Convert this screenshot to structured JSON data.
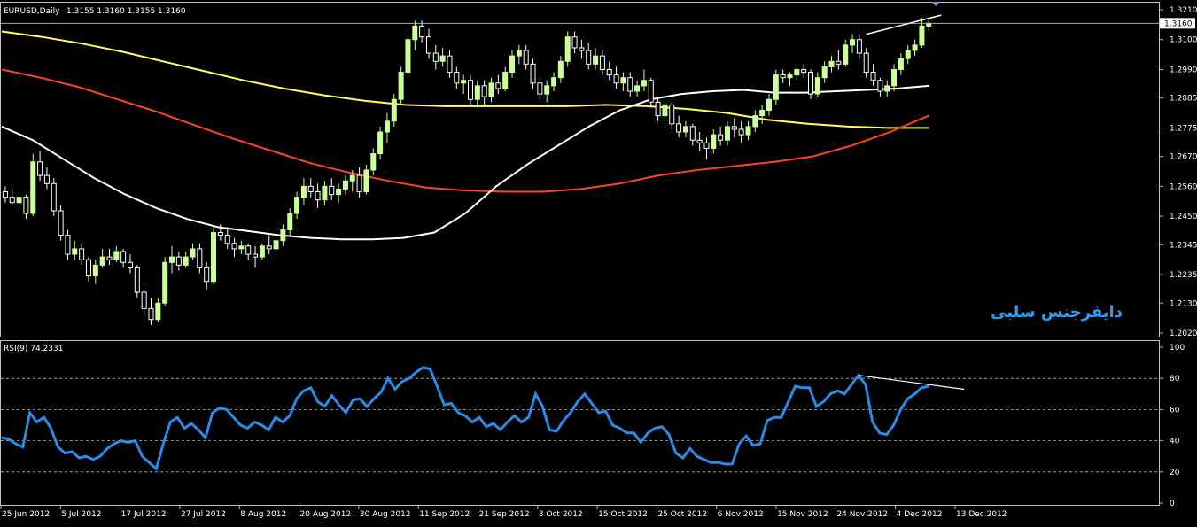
{
  "chart_data": [
    {
      "type": "candlestick",
      "title": "EURUSD,Daily",
      "ohlc_text": "1.3155 1.3160 1.3155 1.3160",
      "current_price": "1.3160",
      "annotation": "دایفرجنس سلبی",
      "y_ticks": [
        "1.3210",
        "1.3100",
        "1.2990",
        "1.2885",
        "1.2775",
        "1.2670",
        "1.2560",
        "1.2450",
        "1.2345",
        "1.2235",
        "1.2130",
        "1.2020"
      ],
      "ylim": [
        1.202,
        1.321
      ],
      "candles": [
        [
          1.254,
          1.256,
          1.25,
          1.252
        ],
        [
          1.252,
          1.2545,
          1.249,
          1.25
        ],
        [
          1.25,
          1.253,
          1.248,
          1.252
        ],
        [
          1.252,
          1.253,
          1.244,
          1.246
        ],
        [
          1.246,
          1.268,
          1.245,
          1.265
        ],
        [
          1.265,
          1.269,
          1.258,
          1.26
        ],
        [
          1.26,
          1.263,
          1.255,
          1.257
        ],
        [
          1.257,
          1.259,
          1.245,
          1.247
        ],
        [
          1.247,
          1.249,
          1.236,
          1.238
        ],
        [
          1.238,
          1.24,
          1.229,
          1.231
        ],
        [
          1.231,
          1.236,
          1.229,
          1.233
        ],
        [
          1.233,
          1.235,
          1.227,
          1.229
        ],
        [
          1.229,
          1.23,
          1.221,
          1.223
        ],
        [
          1.223,
          1.229,
          1.22,
          1.227
        ],
        [
          1.227,
          1.233,
          1.226,
          1.23
        ],
        [
          1.23,
          1.233,
          1.227,
          1.229
        ],
        [
          1.229,
          1.234,
          1.228,
          1.232
        ],
        [
          1.232,
          1.233,
          1.226,
          1.228
        ],
        [
          1.228,
          1.231,
          1.224,
          1.226
        ],
        [
          1.226,
          1.227,
          1.215,
          1.217
        ],
        [
          1.217,
          1.218,
          1.208,
          1.211
        ],
        [
          1.211,
          1.215,
          1.205,
          1.207
        ],
        [
          1.207,
          1.215,
          1.206,
          1.213
        ],
        [
          1.213,
          1.23,
          1.212,
          1.228
        ],
        [
          1.228,
          1.234,
          1.224,
          1.23
        ],
        [
          1.23,
          1.232,
          1.225,
          1.227
        ],
        [
          1.227,
          1.232,
          1.226,
          1.23
        ],
        [
          1.23,
          1.235,
          1.229,
          1.233
        ],
        [
          1.233,
          1.235,
          1.224,
          1.226
        ],
        [
          1.226,
          1.228,
          1.218,
          1.221
        ],
        [
          1.221,
          1.241,
          1.22,
          1.239
        ],
        [
          1.239,
          1.242,
          1.236,
          1.238
        ],
        [
          1.238,
          1.241,
          1.233,
          1.235
        ],
        [
          1.235,
          1.237,
          1.23,
          1.233
        ],
        [
          1.233,
          1.236,
          1.231,
          1.234
        ],
        [
          1.234,
          1.235,
          1.229,
          1.231
        ],
        [
          1.231,
          1.234,
          1.226,
          1.23
        ],
        [
          1.23,
          1.235,
          1.229,
          1.234
        ],
        [
          1.234,
          1.238,
          1.231,
          1.233
        ],
        [
          1.233,
          1.237,
          1.23,
          1.236
        ],
        [
          1.236,
          1.242,
          1.234,
          1.24
        ],
        [
          1.24,
          1.248,
          1.238,
          1.246
        ],
        [
          1.246,
          1.254,
          1.244,
          1.252
        ],
        [
          1.252,
          1.259,
          1.249,
          1.256
        ],
        [
          1.256,
          1.259,
          1.252,
          1.254
        ],
        [
          1.254,
          1.257,
          1.248,
          1.251
        ],
        [
          1.251,
          1.258,
          1.249,
          1.256
        ],
        [
          1.256,
          1.259,
          1.251,
          1.253
        ],
        [
          1.253,
          1.257,
          1.25,
          1.255
        ],
        [
          1.255,
          1.26,
          1.253,
          1.258
        ],
        [
          1.258,
          1.262,
          1.254,
          1.26
        ],
        [
          1.26,
          1.263,
          1.252,
          1.254
        ],
        [
          1.254,
          1.264,
          1.253,
          1.262
        ],
        [
          1.262,
          1.27,
          1.26,
          1.268
        ],
        [
          1.268,
          1.278,
          1.266,
          1.276
        ],
        [
          1.276,
          1.283,
          1.272,
          1.28
        ],
        [
          1.28,
          1.29,
          1.278,
          1.288
        ],
        [
          1.288,
          1.3,
          1.286,
          1.298
        ],
        [
          1.298,
          1.312,
          1.296,
          1.31
        ],
        [
          1.31,
          1.317,
          1.306,
          1.315
        ],
        [
          1.315,
          1.317,
          1.309,
          1.311
        ],
        [
          1.311,
          1.314,
          1.303,
          1.305
        ],
        [
          1.305,
          1.308,
          1.299,
          1.302
        ],
        [
          1.302,
          1.307,
          1.3,
          1.304
        ],
        [
          1.304,
          1.306,
          1.296,
          1.298
        ],
        [
          1.298,
          1.3,
          1.292,
          1.294
        ],
        [
          1.294,
          1.297,
          1.29,
          1.295
        ],
        [
          1.295,
          1.297,
          1.286,
          1.288
        ],
        [
          1.288,
          1.295,
          1.285,
          1.293
        ],
        [
          1.293,
          1.295,
          1.286,
          1.289
        ],
        [
          1.289,
          1.296,
          1.287,
          1.294
        ],
        [
          1.294,
          1.297,
          1.29,
          1.292
        ],
        [
          1.292,
          1.3,
          1.291,
          1.298
        ],
        [
          1.298,
          1.306,
          1.296,
          1.304
        ],
        [
          1.304,
          1.308,
          1.301,
          1.306
        ],
        [
          1.306,
          1.308,
          1.299,
          1.301
        ],
        [
          1.301,
          1.303,
          1.292,
          1.294
        ],
        [
          1.294,
          1.296,
          1.287,
          1.29
        ],
        [
          1.29,
          1.295,
          1.287,
          1.293
        ],
        [
          1.293,
          1.298,
          1.291,
          1.296
        ],
        [
          1.296,
          1.304,
          1.294,
          1.302
        ],
        [
          1.302,
          1.313,
          1.3,
          1.311
        ],
        [
          1.311,
          1.313,
          1.305,
          1.307
        ],
        [
          1.307,
          1.31,
          1.303,
          1.306
        ],
        [
          1.306,
          1.309,
          1.299,
          1.301
        ],
        [
          1.301,
          1.307,
          1.299,
          1.304
        ],
        [
          1.304,
          1.306,
          1.297,
          1.299
        ],
        [
          1.299,
          1.302,
          1.295,
          1.297
        ],
        [
          1.297,
          1.3,
          1.292,
          1.294
        ],
        [
          1.294,
          1.298,
          1.291,
          1.296
        ],
        [
          1.296,
          1.298,
          1.289,
          1.291
        ],
        [
          1.291,
          1.295,
          1.289,
          1.293
        ],
        [
          1.293,
          1.299,
          1.291,
          1.295
        ],
        [
          1.295,
          1.296,
          1.285,
          1.287
        ],
        [
          1.287,
          1.289,
          1.28,
          1.282
        ],
        [
          1.282,
          1.288,
          1.28,
          1.286
        ],
        [
          1.286,
          1.287,
          1.277,
          1.279
        ],
        [
          1.279,
          1.282,
          1.274,
          1.276
        ],
        [
          1.276,
          1.28,
          1.274,
          1.278
        ],
        [
          1.278,
          1.279,
          1.271,
          1.273
        ],
        [
          1.273,
          1.276,
          1.269,
          1.272
        ],
        [
          1.272,
          1.274,
          1.266,
          1.27
        ],
        [
          1.27,
          1.277,
          1.268,
          1.275
        ],
        [
          1.275,
          1.278,
          1.271,
          1.273
        ],
        [
          1.273,
          1.28,
          1.271,
          1.278
        ],
        [
          1.278,
          1.281,
          1.274,
          1.277
        ],
        [
          1.277,
          1.28,
          1.272,
          1.275
        ],
        [
          1.275,
          1.28,
          1.273,
          1.278
        ],
        [
          1.278,
          1.284,
          1.276,
          1.282
        ],
        [
          1.282,
          1.286,
          1.279,
          1.284
        ],
        [
          1.284,
          1.29,
          1.282,
          1.288
        ],
        [
          1.288,
          1.299,
          1.286,
          1.297
        ],
        [
          1.297,
          1.299,
          1.294,
          1.296
        ],
        [
          1.296,
          1.298,
          1.293,
          1.297
        ],
        [
          1.297,
          1.301,
          1.295,
          1.299
        ],
        [
          1.299,
          1.301,
          1.296,
          1.298
        ],
        [
          1.298,
          1.299,
          1.288,
          1.29
        ],
        [
          1.29,
          1.298,
          1.289,
          1.296
        ],
        [
          1.296,
          1.302,
          1.294,
          1.3
        ],
        [
          1.3,
          1.304,
          1.298,
          1.302
        ],
        [
          1.302,
          1.306,
          1.299,
          1.301
        ],
        [
          1.301,
          1.31,
          1.3,
          1.308
        ],
        [
          1.308,
          1.312,
          1.305,
          1.31
        ],
        [
          1.31,
          1.312,
          1.303,
          1.305
        ],
        [
          1.305,
          1.307,
          1.296,
          1.298
        ],
        [
          1.298,
          1.301,
          1.293,
          1.295
        ],
        [
          1.295,
          1.296,
          1.289,
          1.291
        ],
        [
          1.291,
          1.295,
          1.289,
          1.293
        ],
        [
          1.293,
          1.301,
          1.291,
          1.299
        ],
        [
          1.299,
          1.305,
          1.297,
          1.303
        ],
        [
          1.303,
          1.308,
          1.301,
          1.306
        ],
        [
          1.306,
          1.31,
          1.304,
          1.308
        ],
        [
          1.308,
          1.318,
          1.307,
          1.315
        ],
        [
          1.315,
          1.318,
          1.313,
          1.316
        ]
      ],
      "ma_series": [
        {
          "color": "#ffff66",
          "values": [
            1.313,
            1.311,
            1.3085,
            1.3055,
            1.302,
            1.2985,
            1.295,
            1.292,
            1.2895,
            1.2875,
            1.286,
            1.2855,
            1.2855,
            1.2855,
            1.2855,
            1.286,
            1.2855,
            1.2845,
            1.283,
            1.2805,
            1.279,
            1.278,
            1.2775,
            1.2775
          ]
        },
        {
          "color": "#ff4422",
          "values": [
            1.299,
            1.296,
            1.2925,
            1.288,
            1.2835,
            1.2785,
            1.2735,
            1.269,
            1.2645,
            1.261,
            1.258,
            1.2555,
            1.2545,
            1.254,
            1.254,
            1.255,
            1.257,
            1.26,
            1.262,
            1.2635,
            1.265,
            1.267,
            1.271,
            1.276,
            1.282
          ]
        },
        {
          "color": "#ffffff",
          "values": [
            1.278,
            1.273,
            1.266,
            1.259,
            1.253,
            1.248,
            1.244,
            1.241,
            1.2395,
            1.238,
            1.237,
            1.2365,
            1.2365,
            1.237,
            1.239,
            1.246,
            1.256,
            1.264,
            1.271,
            1.278,
            1.284,
            1.288,
            1.29,
            1.291,
            1.2915,
            1.2905,
            1.2905,
            1.291,
            1.2915,
            1.292,
            1.293
          ]
        }
      ],
      "trendline": [
        [
          1.312,
          1.319
        ]
      ]
    },
    {
      "type": "line",
      "title": "RSI(9) 74.2331",
      "y_ticks": [
        "100",
        "80",
        "60",
        "40",
        "20",
        "0"
      ],
      "ylim": [
        0,
        100
      ],
      "x_ticks": [
        "25 Jun 2012",
        "5 Jul 2012",
        "17 Jul 2012",
        "27 Jul 2012",
        "8 Aug 2012",
        "20 Aug 2012",
        "30 Aug 2012",
        "11 Sep 2012",
        "21 Sep 2012",
        "3 Oct 2012",
        "15 Oct 2012",
        "25 Oct 2012",
        "6 Nov 2012",
        "15 Nov 2012",
        "24 Nov 2012",
        "4 Dec 2012",
        "13 Dec 2012"
      ],
      "values": [
        42,
        41,
        38,
        36,
        58,
        52,
        55,
        48,
        36,
        32,
        33,
        29,
        30,
        28,
        30,
        35,
        38,
        40,
        39,
        40,
        30,
        26,
        22,
        38,
        52,
        55,
        48,
        51,
        47,
        42,
        58,
        61,
        60,
        55,
        50,
        48,
        52,
        50,
        47,
        55,
        52,
        56,
        67,
        72,
        74,
        65,
        62,
        69,
        63,
        58,
        66,
        67,
        62,
        67,
        71,
        80,
        73,
        78,
        80,
        84,
        87,
        86,
        75,
        63,
        64,
        58,
        56,
        52,
        55,
        49,
        51,
        47,
        52,
        56,
        52,
        55,
        70,
        62,
        47,
        46,
        53,
        58,
        65,
        70,
        64,
        58,
        59,
        50,
        48,
        45,
        45,
        39,
        45,
        48,
        49,
        44,
        32,
        29,
        35,
        30,
        28,
        26,
        26,
        25,
        25,
        38,
        43,
        37,
        38,
        53,
        55,
        55,
        65,
        75,
        74,
        74,
        62,
        65,
        70,
        72,
        70,
        76,
        82,
        76,
        52,
        45,
        44,
        50,
        60,
        67,
        70,
        74,
        75
      ],
      "trendline": [
        [
          82,
          73
        ]
      ]
    }
  ]
}
